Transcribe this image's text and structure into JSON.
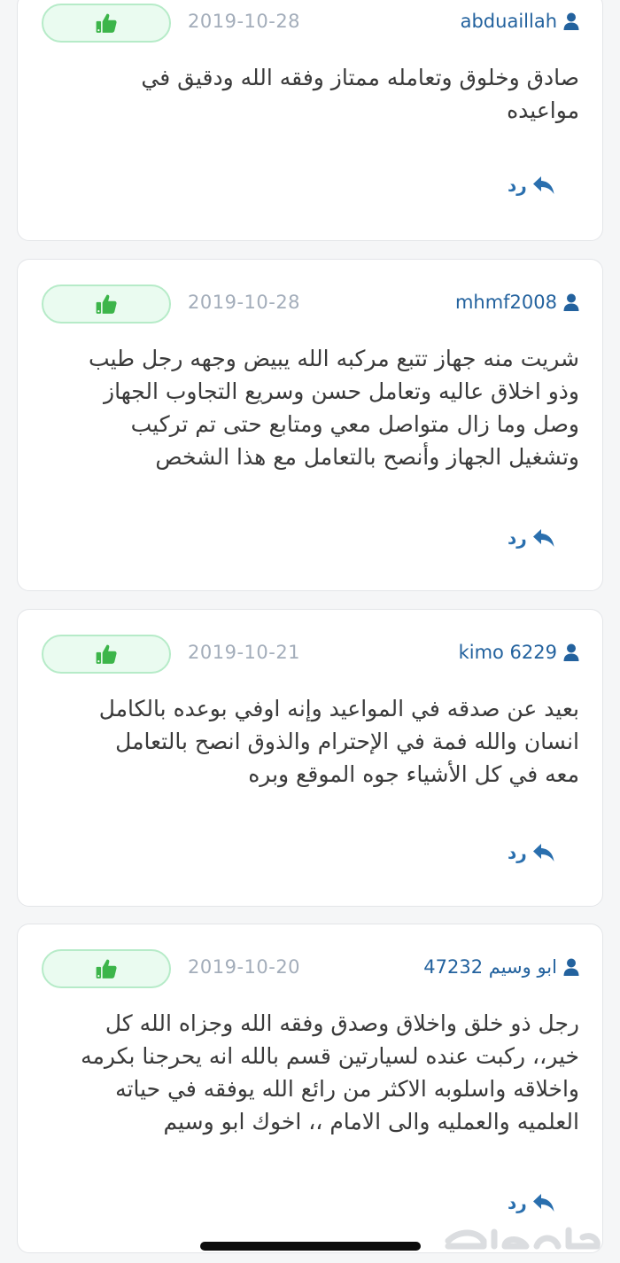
{
  "reviews": [
    {
      "user": "abduaillah",
      "date": "2019-10-28",
      "comment": "صادق وخلوق وتعامله ممتاز وفقه الله ودقيق في\nمواعيده",
      "reply_label": "رد"
    },
    {
      "user": "mhmf2008",
      "date": "2019-10-28",
      "comment": "شريت منه جهاز تتبع مركبه الله يبيض وجهه رجل طيب\nوذو اخلاق عاليه وتعامل حسن وسريع التجاوب الجهاز\nوصل وما زال متواصل معي ومتابع حتى تم تركيب\nوتشغيل الجهاز وأنصح بالتعامل مع هذا الشخص",
      "reply_label": "رد"
    },
    {
      "user": "kimo 6229",
      "date": "2019-10-21",
      "comment": "بعيد عن صدقه في المواعيد وإنه اوفي بوعده بالكامل\nانسان والله فمة في الإحترام والذوق انصح بالتعامل\nمعه في كل الأشياء جوه الموقع وبره",
      "reply_label": "رد"
    },
    {
      "user": "ابو وسيم 47232",
      "date": "2019-10-20",
      "comment": "رجل ذو خلق واخلاق وصدق وفقه الله وجزاه الله كل\nخير،، ركبت عنده لسيارتين قسم بالله انه يحرجنا بكرمه\nواخلاقه واسلوبه الاكثر من رائع الله يوفقه في حياته\nالعلميه والعمليه والى الامام ،، اخوك ابو وسيم",
      "reply_label": "رد"
    }
  ],
  "icons": {
    "like": "thumbs-up-icon",
    "user": "user-icon",
    "reply": "reply-arrow-icon"
  },
  "colors": {
    "accent": "#23629e",
    "like_green": "#3cb54a",
    "like_bg": "#eafbf0",
    "date_gray": "#a3adba"
  },
  "watermark": {
    "text": "حراج"
  }
}
